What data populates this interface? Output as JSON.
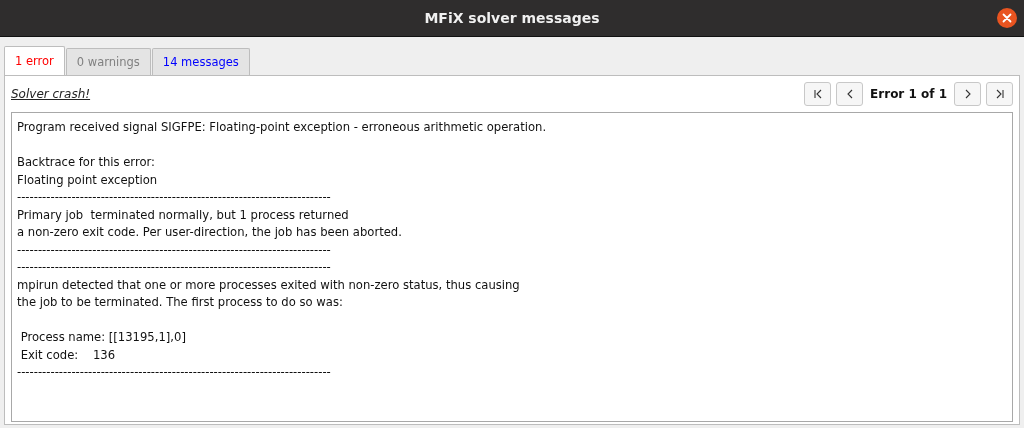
{
  "window": {
    "title": "MFiX solver messages"
  },
  "tabs": [
    {
      "label": "1 error",
      "selected": true,
      "color": "#ff0000"
    },
    {
      "label": "0 warnings",
      "selected": false,
      "color": "#808080"
    },
    {
      "label": "14 messages",
      "selected": false,
      "color": "#0000ff"
    }
  ],
  "header": {
    "title": "Solver crash!",
    "counter": "Error 1 of 1",
    "nav_buttons": [
      {
        "kind": "first"
      },
      {
        "kind": "previous"
      },
      {
        "kind": "next"
      },
      {
        "kind": "last"
      }
    ]
  },
  "message": {
    "paragraphs": [
      [
        "Program received signal SIGFPE: Floating-point exception - erroneous arithmetic operation."
      ],
      [
        "Backtrace for this error:",
        "Floating point exception",
        "---------------------------------------------------------------------------",
        "Primary job  terminated normally, but 1 process returned",
        "a non-zero exit code. Per user-direction, the job has been aborted.",
        "---------------------------------------------------------------------------",
        "---------------------------------------------------------------------------",
        "mpirun detected that one or more processes exited with non-zero status, thus causing",
        "the job to be terminated. The first process to do so was:"
      ],
      [
        " Process name: [[13195,1],0]",
        " Exit code:    136",
        "---------------------------------------------------------------------------"
      ]
    ]
  }
}
